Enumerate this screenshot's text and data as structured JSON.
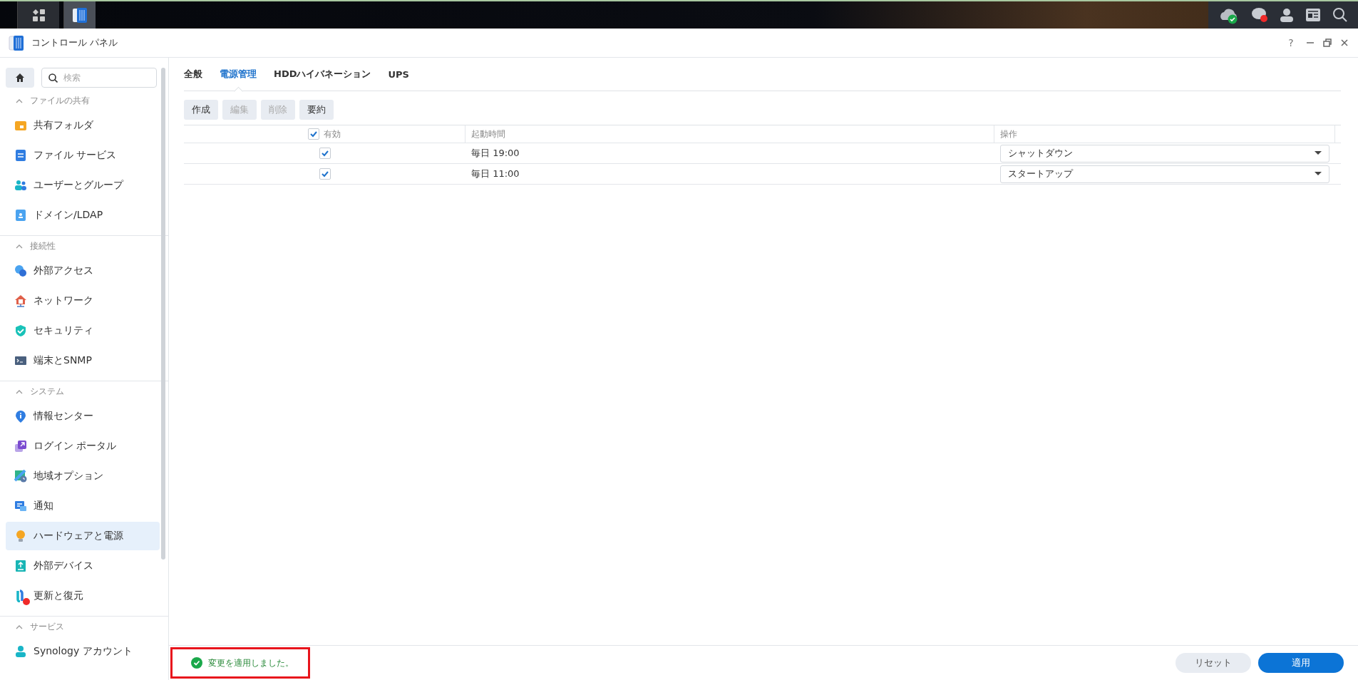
{
  "window": {
    "title": "コントロール パネル",
    "controls": [
      "?"
    ]
  },
  "search": {
    "placeholder": "検索"
  },
  "sidebar": {
    "sections": [
      {
        "title": "ファイルの共有",
        "expanded": true,
        "items": [
          {
            "label": "共有フォルダ",
            "selected": false
          },
          {
            "label": "ファイル サービス",
            "selected": false
          },
          {
            "label": "ユーザーとグループ",
            "selected": false
          },
          {
            "label": "ドメイン/LDAP",
            "selected": false
          }
        ]
      },
      {
        "title": "接続性",
        "expanded": true,
        "items": [
          {
            "label": "外部アクセス",
            "selected": false
          },
          {
            "label": "ネットワーク",
            "selected": false
          },
          {
            "label": "セキュリティ",
            "selected": false
          },
          {
            "label": "端末とSNMP",
            "selected": false
          }
        ]
      },
      {
        "title": "システム",
        "expanded": true,
        "items": [
          {
            "label": "情報センター",
            "selected": false
          },
          {
            "label": "ログイン ポータル",
            "selected": false
          },
          {
            "label": "地域オプション",
            "selected": false
          },
          {
            "label": "通知",
            "selected": false
          },
          {
            "label": "ハードウェアと電源",
            "selected": true
          },
          {
            "label": "外部デバイス",
            "selected": false
          },
          {
            "label": "更新と復元",
            "selected": false,
            "badge": true
          }
        ]
      },
      {
        "title": "サービス",
        "expanded": true,
        "items": [
          {
            "label": "Synology アカウント",
            "selected": false
          }
        ]
      }
    ]
  },
  "tabs": [
    {
      "label": "全般",
      "selected": false
    },
    {
      "label": "電源管理",
      "selected": true
    },
    {
      "label": "HDDハイバネーション",
      "selected": false
    },
    {
      "label": "UPS",
      "selected": false
    }
  ],
  "toolbar": [
    {
      "label": "作成",
      "disabled": false
    },
    {
      "label": "編集",
      "disabled": true
    },
    {
      "label": "削除",
      "disabled": true
    },
    {
      "label": "要約",
      "disabled": false
    }
  ],
  "table": {
    "columns": [
      {
        "label": "有効",
        "checked": true
      },
      {
        "label": "起動時間"
      },
      {
        "label": "操作"
      }
    ],
    "rows": [
      {
        "enabled": true,
        "time": "毎日 19:00",
        "action": "シャットダウン"
      },
      {
        "enabled": true,
        "time": "毎日 11:00",
        "action": "スタートアップ"
      }
    ]
  },
  "status": {
    "message": "変更を適用しました。",
    "highlighted": true
  },
  "buttons": [
    {
      "label": "リセット",
      "primary": false
    },
    {
      "label": "適用",
      "primary": true
    }
  ]
}
